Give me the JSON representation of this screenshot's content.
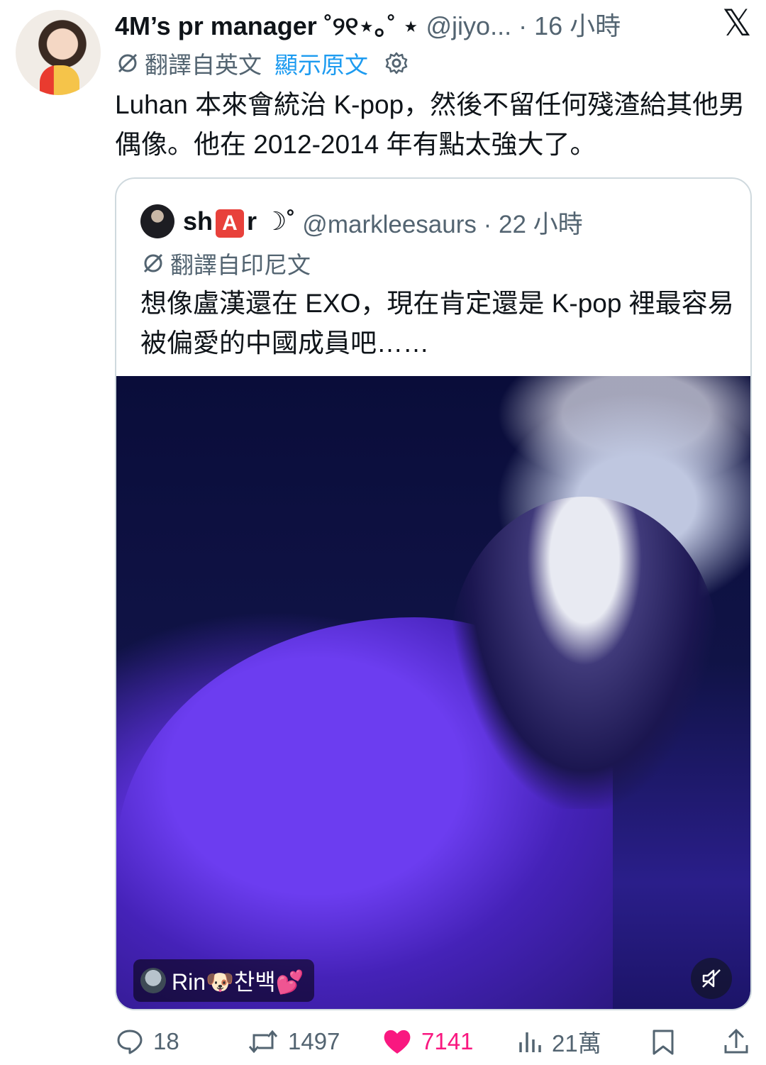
{
  "tweet": {
    "display_name": "4M’s pr manager ˚୨୧⋆｡˚ ⋆",
    "handle_meta": "@jiyo... · 16 小時",
    "translated_label": "翻譯自英文",
    "show_original": "顯示原文",
    "text": "Luhan 本來會統治 K-pop，然後不留任何殘渣給其他男偶像。他在 2012-2014 年有點太強大了。",
    "logo": "𝕏"
  },
  "quote": {
    "name_prefix": "sh",
    "name_badge": "A",
    "name_suffix": "r ☽˚",
    "handle_meta": "@markleesaurs · 22 小時",
    "translated_label": "翻譯自印尼文",
    "text": "想像盧漢還在 EXO，現在肯定還是 K-pop 裡最容易被偏愛的中國成員吧……",
    "watermark_text": "Rin🐶찬백💕"
  },
  "actions": {
    "reply_count": "18",
    "retweet_count": "1497",
    "like_count": "7141",
    "views_count": "21萬"
  },
  "icons": {
    "translate": "translate-icon",
    "settings": "gear-icon",
    "reply": "reply-icon",
    "retweet": "retweet-icon",
    "like": "heart-icon",
    "views": "views-icon",
    "bookmark": "bookmark-icon",
    "share": "share-icon",
    "mute": "mute-icon"
  },
  "colors": {
    "link": "#1d9bf0",
    "meta": "#536471",
    "like": "#f91880",
    "badge": "#e8413b"
  }
}
